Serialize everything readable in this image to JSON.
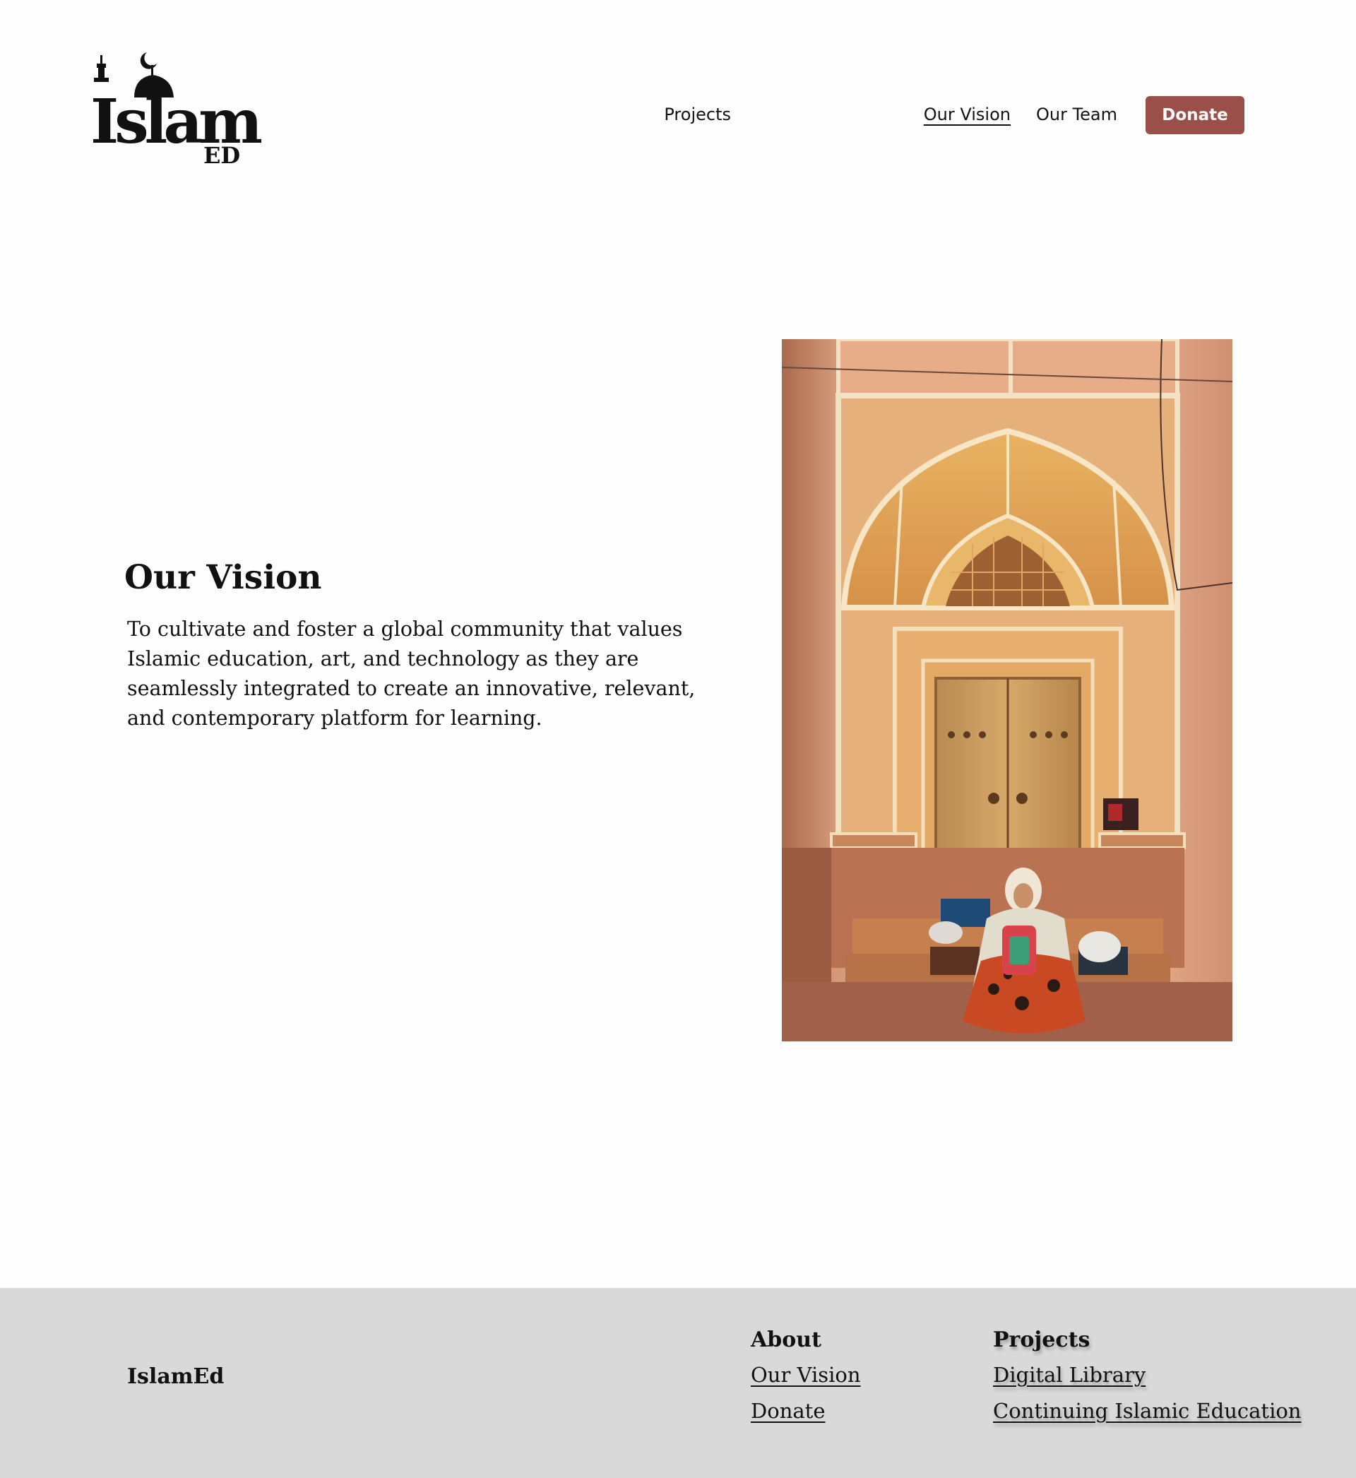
{
  "brand": {
    "logo_text": "Islam",
    "logo_suffix": "ED",
    "logo_icon": "mosque-minaret-crescent-icon"
  },
  "nav": {
    "items": [
      {
        "label": "Projects",
        "active": false
      },
      {
        "label": "Our Vision",
        "active": true
      },
      {
        "label": "Our Team",
        "active": false
      }
    ],
    "donate_label": "Donate"
  },
  "main": {
    "title": "Our Vision",
    "body": "To cultivate and foster a global community that values Islamic education, art, and technology as they are seamlessly integrated to create an innovative, relevant, and contemporary platform for learning.",
    "image_subject": "woman-sitting-before-arched-wooden-door-photo"
  },
  "footer": {
    "brand": "IslamEd",
    "columns": [
      {
        "heading": "About",
        "links": [
          "Our Vision",
          "Donate"
        ]
      },
      {
        "heading": "Projects",
        "links": [
          "Digital Library",
          "Continuing Islamic Education"
        ]
      }
    ]
  },
  "colors": {
    "accent": "#9b4f49",
    "footer_bg": "#d9d9d9",
    "text": "#111111",
    "page_bg": "#fefefe"
  }
}
